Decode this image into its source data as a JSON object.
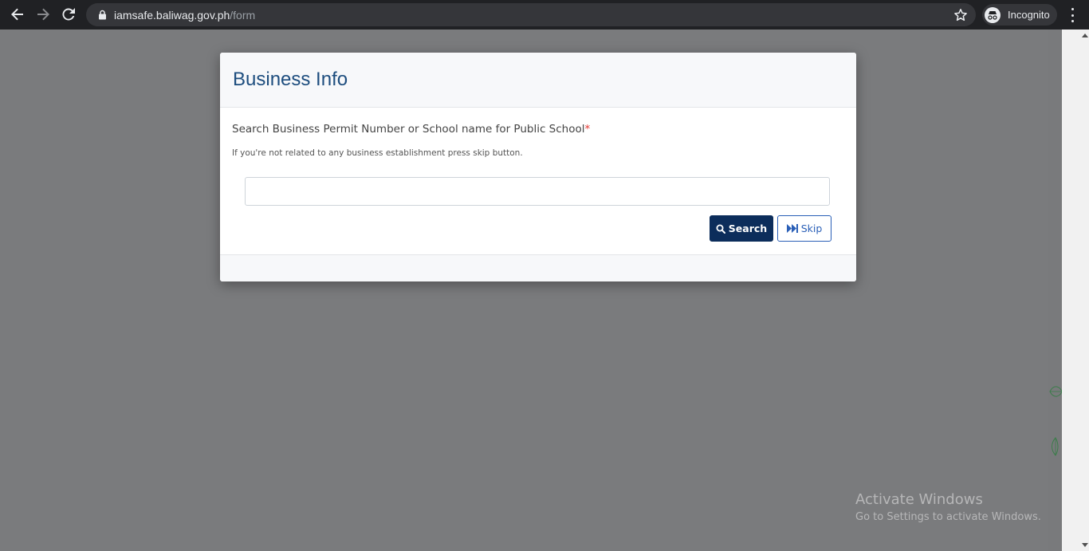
{
  "browser": {
    "url_host": "iamsafe.baliwag.gov.ph",
    "url_path": "/form",
    "profile_label": "Incognito"
  },
  "modal": {
    "title": "Business Info",
    "field_label": "Search Business Permit Number or School name for Public School",
    "required_mark": "*",
    "help_text": "If you're not related to any business establishment press skip button.",
    "search_value": "",
    "search_button_label": "Search",
    "skip_button_label": "Skip"
  },
  "watermark": {
    "title": "Activate Windows",
    "subtitle": "Go to Settings to activate Windows."
  },
  "icons": {
    "back": "back-arrow-icon",
    "forward": "forward-arrow-icon",
    "reload": "reload-icon",
    "lock": "lock-icon",
    "star": "star-icon",
    "incognito": "incognito-icon",
    "menu": "kebab-menu-icon",
    "search": "search-icon",
    "skip": "fast-forward-icon"
  },
  "colors": {
    "modal_title": "#1d4d7e",
    "primary_button": "#0c2d5b",
    "outline_button": "#2a5fb7",
    "required": "#e3342f",
    "overlay": "#7a7b7d"
  }
}
